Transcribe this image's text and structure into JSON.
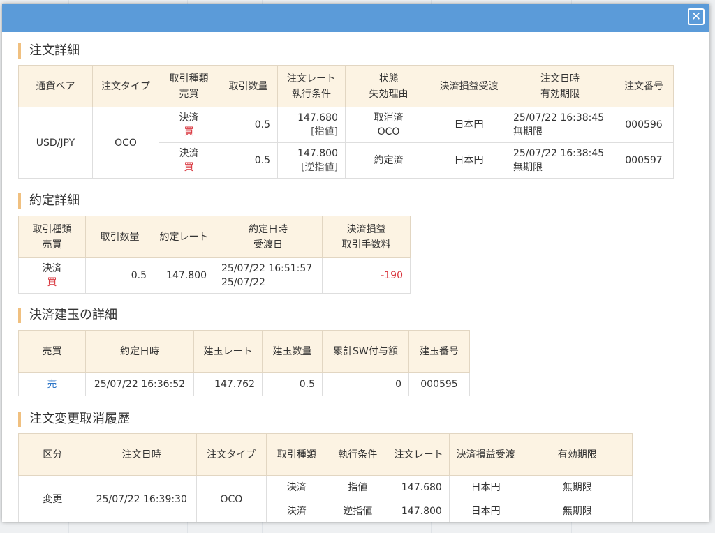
{
  "dialog": {
    "close_label": "✕"
  },
  "order_detail": {
    "title": "注文詳細",
    "headers": [
      [
        "通貨ペア"
      ],
      [
        "注文タイプ"
      ],
      [
        "取引種類",
        "売買"
      ],
      [
        "取引数量"
      ],
      [
        "注文レート",
        "執行条件"
      ],
      [
        "状態",
        "失効理由"
      ],
      [
        "決済損益受渡"
      ],
      [
        "注文日時",
        "有効期限"
      ],
      [
        "注文番号"
      ]
    ],
    "pair": "USD/JPY",
    "order_type": "OCO",
    "rows": [
      {
        "kind": "決済",
        "side": "買",
        "qty": "0.5",
        "rate": "147.680",
        "cond": "[指値]",
        "state": "取消済",
        "reason": "OCO",
        "settle": "日本円",
        "datetime": "25/07/22 16:38:45",
        "expiry": "無期限",
        "order_no": "000596"
      },
      {
        "kind": "決済",
        "side": "買",
        "qty": "0.5",
        "rate": "147.800",
        "cond": "[逆指値]",
        "state": "約定済",
        "reason": "",
        "settle": "日本円",
        "datetime": "25/07/22 16:38:45",
        "expiry": "無期限",
        "order_no": "000597"
      }
    ]
  },
  "execution_detail": {
    "title": "約定詳細",
    "headers": [
      [
        "取引種類",
        "売買"
      ],
      [
        "取引数量"
      ],
      [
        "約定レート"
      ],
      [
        "約定日時",
        "受渡日"
      ],
      [
        "決済損益",
        "取引手数料"
      ]
    ],
    "row": {
      "kind": "決済",
      "side": "買",
      "qty": "0.5",
      "rate": "147.800",
      "datetime": "25/07/22 16:51:57",
      "delivery": "25/07/22",
      "pnl": "-190"
    }
  },
  "position_detail": {
    "title": "決済建玉の詳細",
    "headers": [
      "売買",
      "約定日時",
      "建玉レート",
      "建玉数量",
      "累計SW付与額",
      "建玉番号"
    ],
    "row": {
      "side": "売",
      "datetime": "25/07/22 16:36:52",
      "rate": "147.762",
      "qty": "0.5",
      "swap": "0",
      "pos_no": "000595"
    }
  },
  "history": {
    "title": "注文変更取消履歴",
    "headers": [
      "区分",
      "注文日時",
      "注文タイプ",
      "取引種類",
      "執行条件",
      "注文レート",
      "決済損益受渡",
      "有効期限"
    ],
    "category": "変更",
    "datetime": "25/07/22 16:39:30",
    "order_type": "OCO",
    "rows": [
      {
        "kind": "決済",
        "cond": "指値",
        "rate": "147.680",
        "settle": "日本円",
        "expiry": "無期限"
      },
      {
        "kind": "決済",
        "cond": "逆指値",
        "rate": "147.800",
        "settle": "日本円",
        "expiry": "無期限"
      }
    ]
  },
  "colors": {
    "header_bar": "#5b9bd9",
    "buy": "#d9363e",
    "sell": "#2e76c7",
    "th_bg": "#fcf3e3",
    "accent": "#f0c080"
  }
}
